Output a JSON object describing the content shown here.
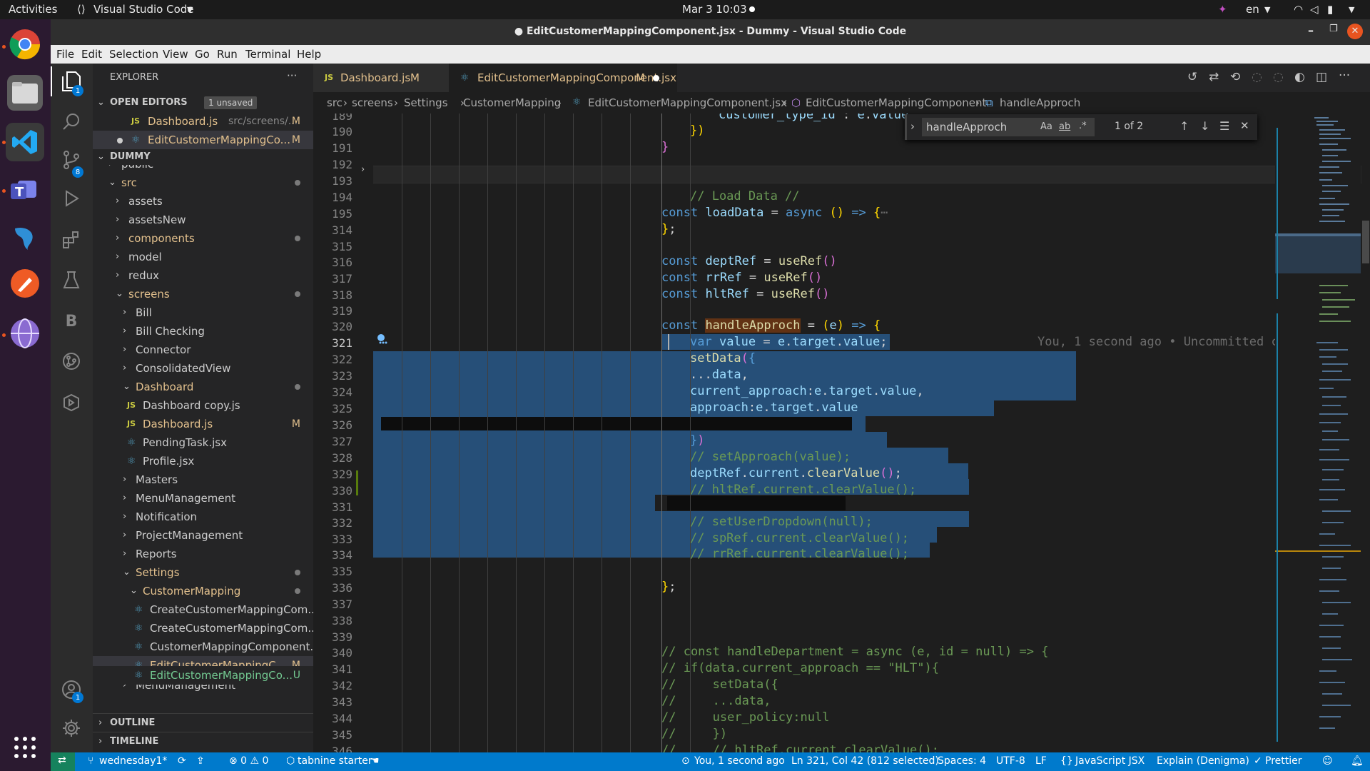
{
  "gnome": {
    "activities": "Activities",
    "app_name": "Visual Studio Code",
    "datetime": "Mar 3  10:03",
    "lang": "en"
  },
  "window": {
    "title": "● EditCustomerMappingComponent.jsx - Dummy - Visual Studio Code"
  },
  "menu": [
    "File",
    "Edit",
    "Selection",
    "View",
    "Go",
    "Run",
    "Terminal",
    "Help"
  ],
  "activity": {
    "explorer_badge": "1",
    "scm_badge": "8",
    "accounts_badge": "1",
    "b_label": "B"
  },
  "sidebar": {
    "title": "EXPLORER",
    "more": "···",
    "open_editors": "OPEN EDITORS",
    "unsaved": "1 unsaved",
    "open_files": [
      {
        "icon": "JS",
        "name": "Dashboard.js",
        "path": "src/screens/...",
        "status": "M"
      },
      {
        "icon": "⚛",
        "name": "EditCustomerMappingCo...",
        "path": "",
        "status": "M"
      }
    ],
    "project": "DUMMY",
    "tree": [
      {
        "label": "public",
        "chev": "›"
      },
      {
        "label": "src",
        "chev": "⌄"
      },
      {
        "label": "assets",
        "chev": "›"
      },
      {
        "label": "assetsNew",
        "chev": "›"
      },
      {
        "label": "components",
        "chev": "›"
      },
      {
        "label": "model",
        "chev": "›"
      },
      {
        "label": "redux",
        "chev": "›"
      },
      {
        "label": "screens",
        "chev": "⌄"
      },
      {
        "label": "Bill",
        "chev": "›"
      },
      {
        "label": "Bill Checking",
        "chev": "›"
      },
      {
        "label": "Connector",
        "chev": "›"
      },
      {
        "label": "ConsolidatedView",
        "chev": "›"
      },
      {
        "label": "Dashboard",
        "chev": "⌄"
      },
      {
        "label": "Dashboard copy.js",
        "icon": "JS"
      },
      {
        "label": "Dashboard.js",
        "icon": "JS",
        "status": "M"
      },
      {
        "label": "PendingTask.jsx",
        "icon": "⚛"
      },
      {
        "label": "Profile.jsx",
        "icon": "⚛"
      },
      {
        "label": "Masters",
        "chev": "›"
      },
      {
        "label": "MenuManagement",
        "chev": "›"
      },
      {
        "label": "Notification",
        "chev": "›"
      },
      {
        "label": "ProjectManagement",
        "chev": "›"
      },
      {
        "label": "Reports",
        "chev": "›"
      },
      {
        "label": "Settings",
        "chev": "⌄"
      },
      {
        "label": "CustomerMapping",
        "chev": "⌄"
      },
      {
        "label": "CreateCustomerMappingCom...",
        "icon": "⚛"
      },
      {
        "label": "CreateCustomerMappingCom...",
        "icon": "⚛"
      },
      {
        "label": "CustomerMappingComponent...",
        "icon": "⚛"
      },
      {
        "label": "EditCustomerMappingC...",
        "icon": "⚛",
        "status": "M"
      },
      {
        "label": "EditCustomerMappingCo...",
        "icon": "⚛",
        "status": "U"
      },
      {
        "label": "MenuManagement",
        "chev": "›"
      }
    ],
    "outline": "OUTLINE",
    "timeline": "TIMELINE"
  },
  "tabs": [
    {
      "icon": "JS",
      "label": "Dashboard.js",
      "status": "M"
    },
    {
      "icon": "⚛",
      "label": "EditCustomerMappingComponent.jsx",
      "status": "M"
    }
  ],
  "breadcrumb": [
    "src",
    "screens",
    "Settings",
    "CustomerMapping",
    "EditCustomerMappingComponent.jsx",
    "EditCustomerMappingComponent",
    "handleApproch"
  ],
  "find": {
    "query": "handleApproch",
    "case": "Aa",
    "word": "ab",
    "regex": ".*",
    "count": "1 of 2"
  },
  "line_numbers": [
    "189",
    "190",
    "191",
    "192",
    "193",
    "194",
    "195",
    "314",
    "315",
    "316",
    "317",
    "318",
    "319",
    "320",
    "321",
    "322",
    "323",
    "324",
    "325",
    "326",
    "327",
    "328",
    "329",
    "330",
    "331",
    "332",
    "333",
    "334",
    "335",
    "336",
    "337",
    "338",
    "339",
    "340",
    "341",
    "342",
    "343",
    "344",
    "345",
    "346"
  ],
  "blame": "You, 1 second ago • Uncommitted changes",
  "status": {
    "branch": "wednesday1*",
    "problems": "⊗ 0 ⚠ 0",
    "tabnine": "tabnine starter",
    "blame": "You, 1 second ago",
    "position": "Ln 321, Col 42 (812 selected)",
    "spaces": "Spaces: 4",
    "encoding": "UTF-8",
    "eol": "LF",
    "language": "JavaScript JSX",
    "explain": "Explain (Denigma)",
    "prettier": "Prettier"
  }
}
